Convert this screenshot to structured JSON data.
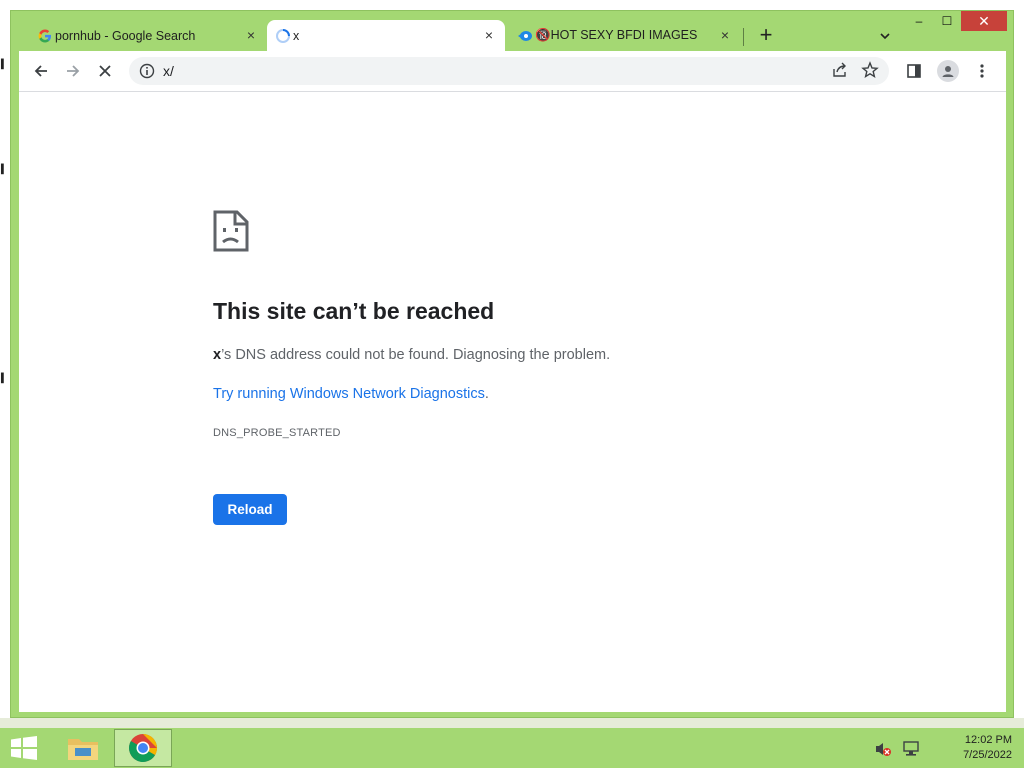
{
  "tabs": [
    {
      "title": "pornhub - Google Search",
      "favicon": "google-icon",
      "close": "×"
    },
    {
      "title": "x",
      "favicon": "loading-spinner-icon",
      "close": "×"
    },
    {
      "title": "🔞HOT SEXY BFDI IMAGES",
      "favicon": "site-icon",
      "close": "×"
    }
  ],
  "new_tab": "+",
  "window_controls": {
    "minimize": "–",
    "maximize": "☐",
    "close": "✕"
  },
  "omnibox": {
    "url": "x/"
  },
  "error": {
    "title": "This site can’t be reached",
    "host": "x",
    "description": "’s DNS address could not be found. Diagnosing the problem.",
    "link_text": "Try running Windows Network Diagnostics",
    "link_suffix": ".",
    "code": "DNS_PROBE_STARTED",
    "button": "Reload"
  },
  "taskbar": {
    "time": "12:02 PM",
    "date": "7/25/2022"
  },
  "colors": {
    "accent": "#1a73e8",
    "window_frame": "#a4d873",
    "close": "#c7423a"
  }
}
